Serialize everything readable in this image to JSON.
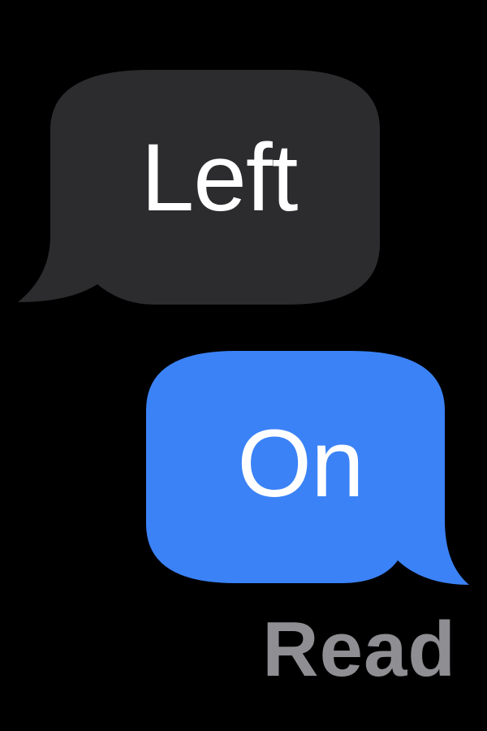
{
  "conversation": {
    "received_message": {
      "text": "Left"
    },
    "sent_message": {
      "text": "On"
    },
    "read_receipt": "Read"
  },
  "colors": {
    "background": "#000000",
    "received_bubble": "#2c2c2e",
    "sent_bubble": "#3b82f6",
    "message_text": "#ffffff",
    "receipt_text": "#8e8e93"
  }
}
